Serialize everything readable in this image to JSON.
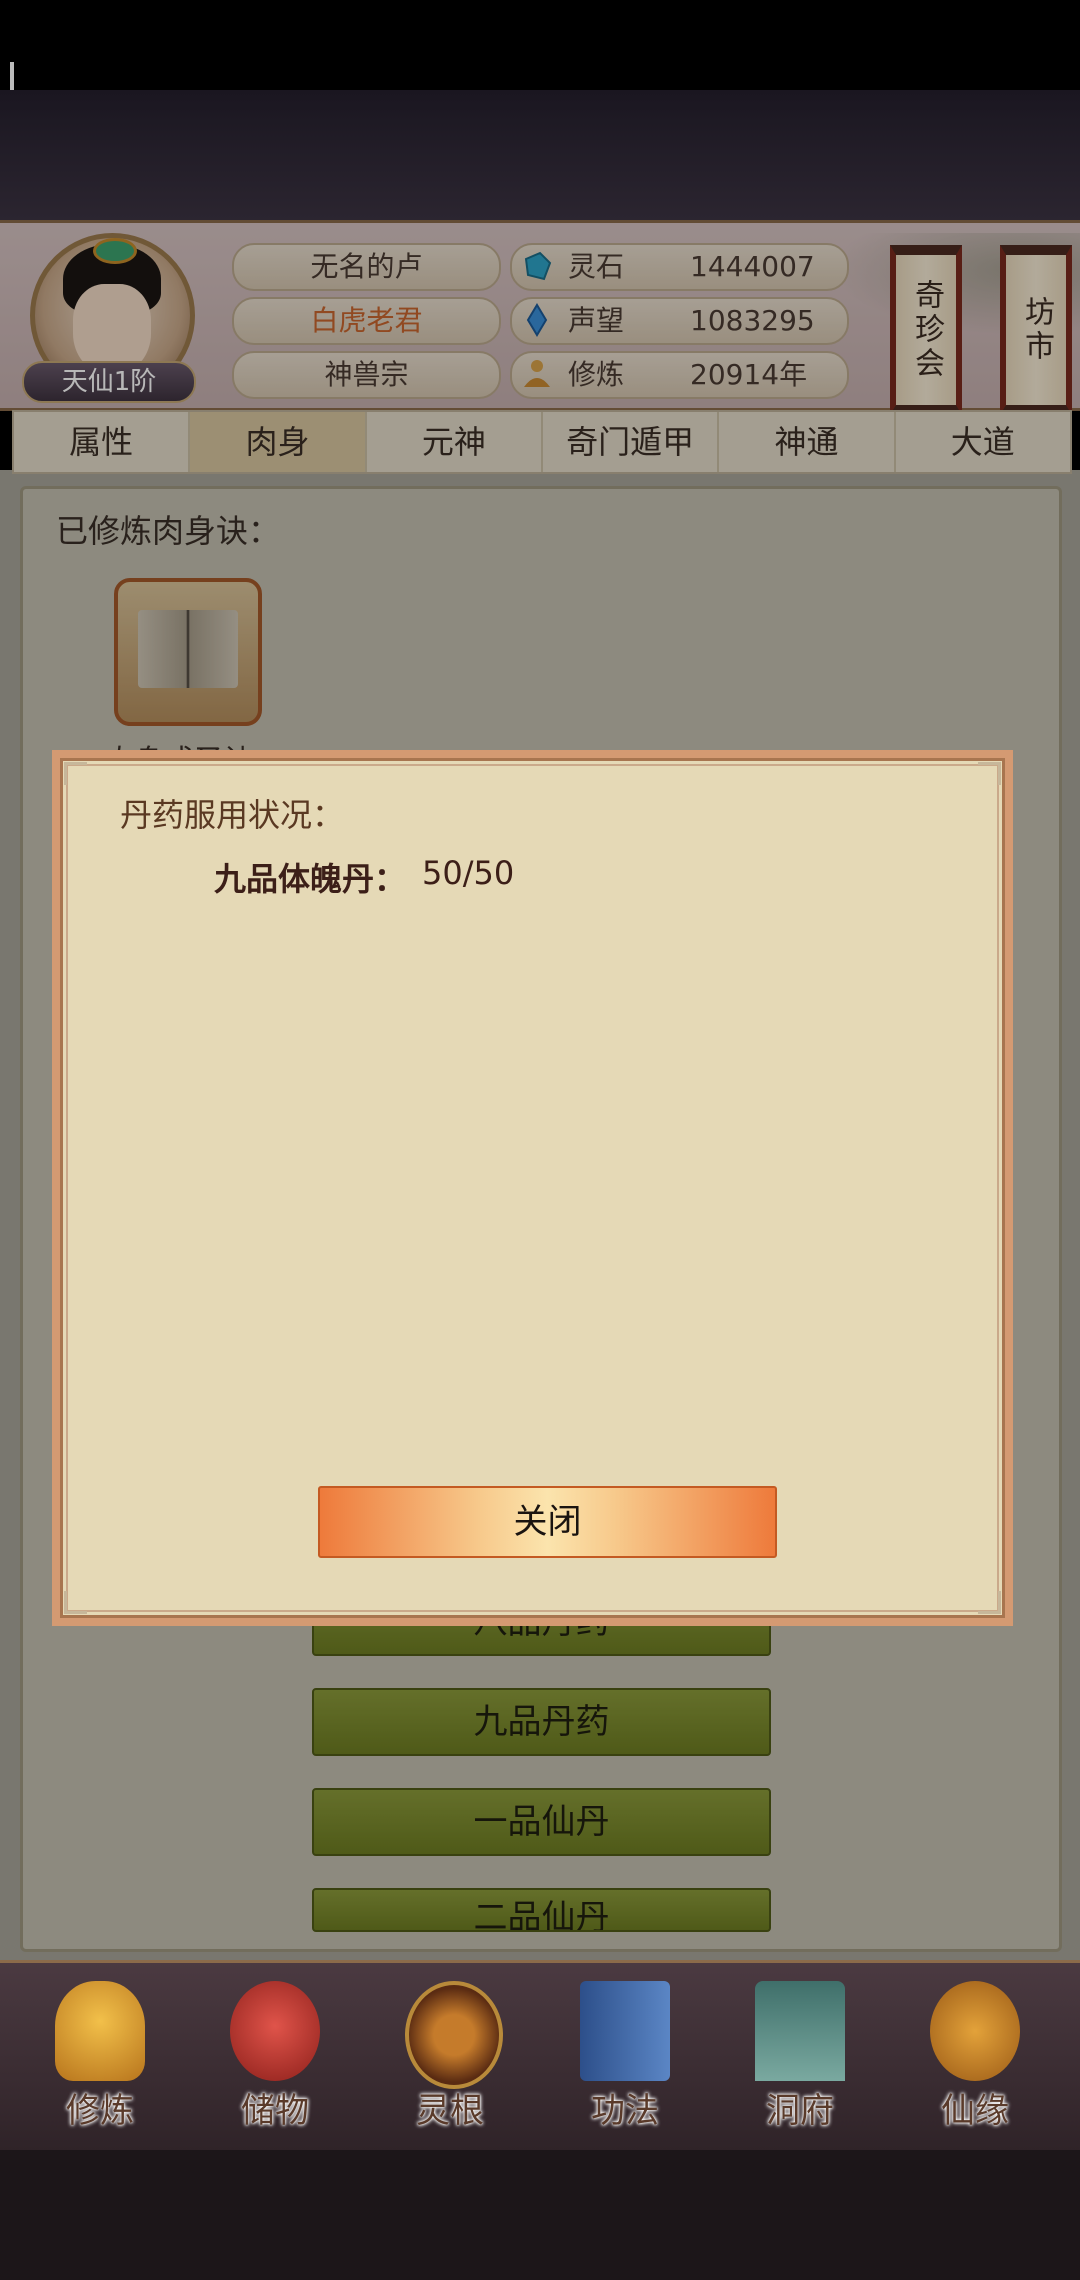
{
  "header": {
    "player_name": "无名的卢",
    "title": "白虎老君",
    "sect": "神兽宗",
    "rank": "天仙1阶",
    "stats": [
      {
        "icon": "spirit-stone-icon",
        "label": "灵石",
        "value": "1444007"
      },
      {
        "icon": "reputation-crystal-icon",
        "label": "声望",
        "value": "1083295"
      },
      {
        "icon": "meditation-icon",
        "label": "修炼",
        "value": "20914年"
      }
    ],
    "scroll_buttons": [
      "奇珍会",
      "坊市"
    ]
  },
  "tabs": [
    "属性",
    "肉身",
    "元神",
    "奇门遁甲",
    "神通",
    "大道"
  ],
  "active_tab": "肉身",
  "panel": {
    "learned_title": "已修炼肉身诀：",
    "book_caption": "肉身成圣诀",
    "buttons": [
      "八品丹药",
      "九品丹药",
      "一品仙丹",
      "二品仙丹"
    ]
  },
  "modal": {
    "title": "丹药服用状况：",
    "pill_name": "九品体魄丹：",
    "pill_value": "50/50",
    "close_label": "关闭"
  },
  "bottom_nav": [
    "修炼",
    "储物",
    "灵根",
    "功法",
    "洞府",
    "仙缘"
  ],
  "colors": {
    "accent_orange": "#ee7a3b",
    "tab_active": "#d8c7a0",
    "green_button": "#7d8c2d",
    "modal_bg": "#e5d9b6"
  }
}
